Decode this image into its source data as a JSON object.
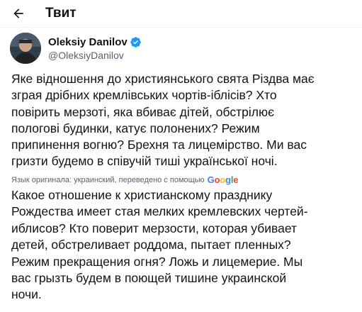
{
  "header": {
    "title": "Твит"
  },
  "author": {
    "name": "Oleksiy Danilov",
    "handle": "@OleksiyDanilov"
  },
  "tweet": {
    "text": "Яке відношення до християнського свята Різдва має\nзграя дрібних кремлівських чортів-іблісів? Хто\nповірить мерзоті, яка вбиває дітей, обстрілює\nпологові будинки, катує полонених? Режим\nприпинення вогню? Брехня та лицемірство. Ми вас\nгризти будемо в співучій тиші української ночі."
  },
  "translation": {
    "note": "Язык оригинала: украинский, переведено с помощью",
    "provider": "Google",
    "text": "Какое отношение к христианскому празднику\nРождества имеет стая мелких кремлевских чертей-\nиблисов? Кто поверит мерзости, которая убивает\nдетей, обстреливает роддома, пытает пленных?\nРежим прекращения огня? Ложь и лицемерие. Мы\nвас грызть будем в поющей тишине украинской\nночи."
  },
  "icons": {
    "back": "arrow-left-icon",
    "verified": "verified-badge-icon"
  },
  "colors": {
    "accent": "#1d9bf0",
    "text": "#0f1419",
    "secondary": "#536471"
  }
}
